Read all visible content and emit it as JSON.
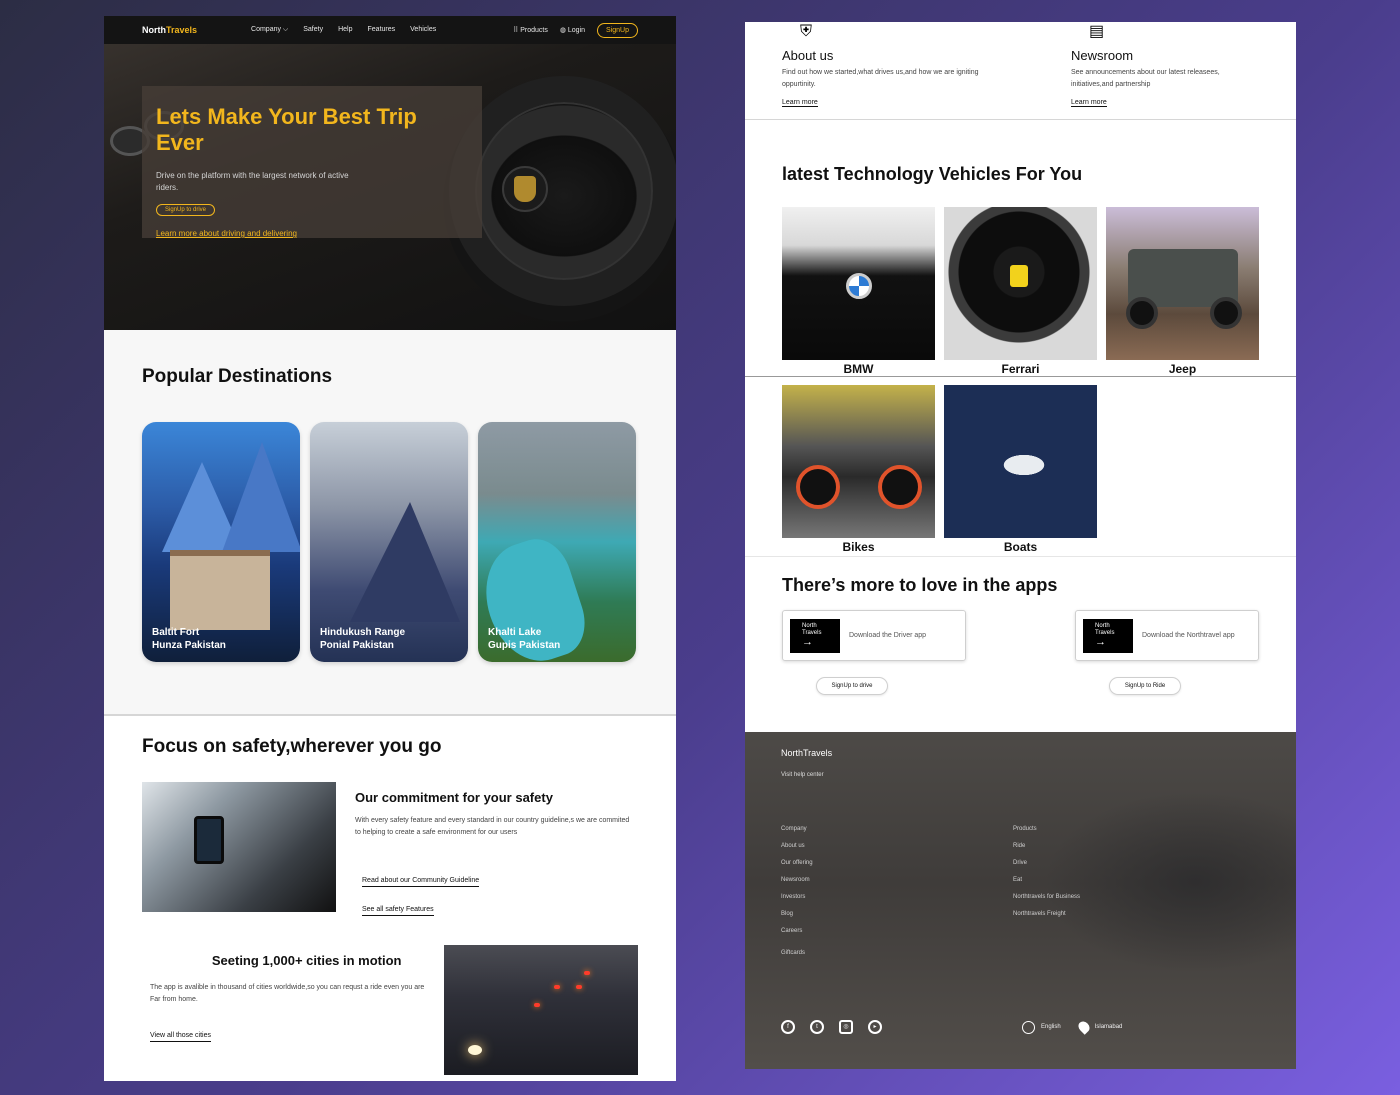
{
  "colors": {
    "accent": "#f2b61d",
    "bg_gradient_start": "#2c2d44",
    "bg_gradient_end": "#7a5fe0"
  },
  "nav": {
    "brand_prefix": "North",
    "brand_suffix": "Travels",
    "links": [
      "Company ⌵",
      "Safety",
      "Help",
      "Features",
      "Vehicles"
    ],
    "products": "Products",
    "login": "Login",
    "signup": "SignUp"
  },
  "hero": {
    "title": "Lets Make Your Best Trip Ever",
    "subtitle": "Drive on the platform with the largest network of active riders.",
    "cta": "SignUp to drive",
    "learn": "Learn more about driving and delivering"
  },
  "destinations": {
    "title": "Popular Destinations",
    "cards": [
      {
        "line1": "Baltit Fort",
        "line2": "Hunza Pakistan"
      },
      {
        "line1": "Hindukush Range",
        "line2": "Ponial Pakistan"
      },
      {
        "line1": "Khalti Lake",
        "line2": "Gupis Pakistan"
      }
    ]
  },
  "safety": {
    "title": "Focus on safety,wherever you go",
    "commit_title": "Our commitment for your safety",
    "commit_text": "With every safety feature and every standard in our country guideline,s we are commited to helping to create a safe environment for our users",
    "link1": "Read about our Community Guideline",
    "link2": "See all safety Features",
    "cities_title": "Seeting 1,000+ cities in motion",
    "cities_text": "The app is avalible in thousand of cities worldwide,so you can requst a ride even you are Far from home.",
    "cities_link": "View all those cities"
  },
  "top": {
    "about_title": "About us",
    "about_text": "Find out how we started,what drives us,and how we are igniting oppurtinity.",
    "about_link": "Learn more",
    "news_title": "Newsroom",
    "news_text": "See announcements about our latest releasees, initiatives,and partnership",
    "news_link": "Learn more"
  },
  "vehicles": {
    "title": "latest Technology Vehicles For You",
    "row1": [
      "BMW",
      "Ferrari",
      "Jeep"
    ],
    "row2": [
      "Bikes",
      "Boats"
    ]
  },
  "apps": {
    "title": "There’s more to love in the apps",
    "tile_line1": "North",
    "tile_line2": "Travels",
    "driver_text": "Download the Driver app",
    "rider_text": "Download the Northtravel app",
    "driver_pill": "SignUp to drive",
    "rider_pill": "SignUp to Ride"
  },
  "footer": {
    "brand": "NorthTravels",
    "help": "Visit help center",
    "company": [
      "Company",
      "About us",
      "Our offering",
      "Newsroom",
      "Investors",
      "Blog",
      "Careers"
    ],
    "giftcards": "Giftcards",
    "products": [
      "Products",
      "Ride",
      "Drive",
      "Eat",
      "Northtravels for Business",
      "Northtravels Freight"
    ],
    "social": [
      "facebook-icon",
      "twitter-icon",
      "instagram-icon",
      "youtube-icon"
    ],
    "language": "English",
    "location": "Islamabad"
  }
}
